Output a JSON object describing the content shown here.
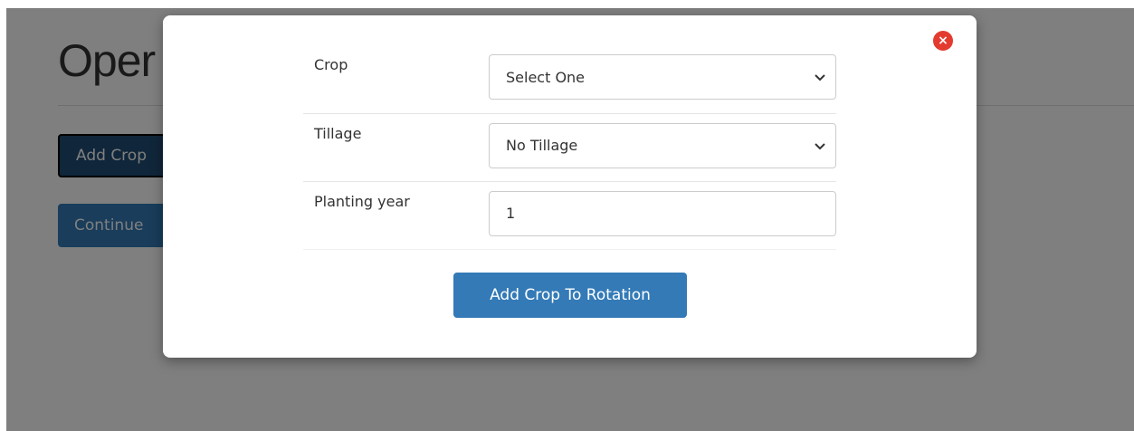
{
  "background": {
    "title": "Oper",
    "add_crop_label": "Add Crop",
    "continue_label": "Continue"
  },
  "modal": {
    "close_icon": "×",
    "fields": {
      "crop": {
        "label": "Crop",
        "value": "Select One"
      },
      "tillage": {
        "label": "Tillage",
        "value": "No Tillage"
      },
      "planting_year": {
        "label": "Planting year",
        "value": "1"
      }
    },
    "submit_label": "Add Crop To Rotation"
  },
  "colors": {
    "primary": "#337ab7",
    "primary_active": "#204d74",
    "close": "#e33b2e"
  }
}
